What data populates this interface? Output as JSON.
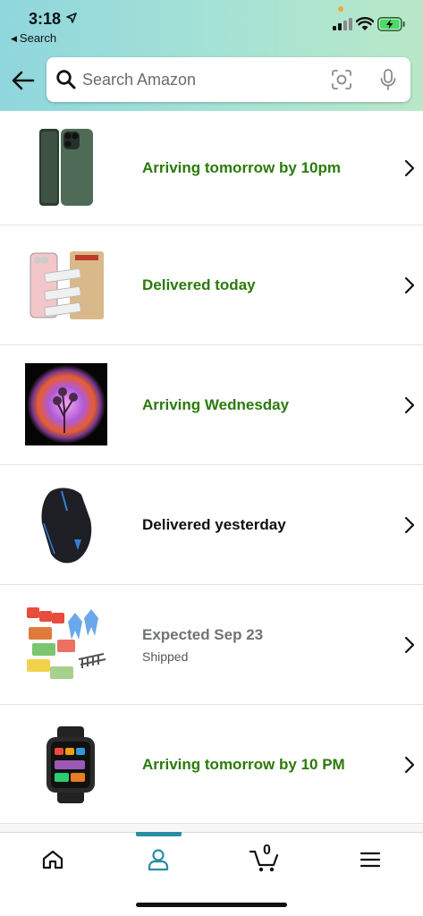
{
  "status_bar": {
    "time": "3:18",
    "back_app": "Search"
  },
  "search": {
    "placeholder": "Search Amazon"
  },
  "orders": [
    {
      "status": "Arriving tomorrow by 10pm",
      "status_color": "#2b7a0b",
      "subtext": "",
      "image": "green-phone-case"
    },
    {
      "status": "Delivered today",
      "status_color": "#2b7a0b",
      "subtext": "",
      "image": "screen-protector-pack"
    },
    {
      "status": "Arriving Wednesday",
      "status_color": "#2b7a0b",
      "subtext": "",
      "image": "sunset-lamp"
    },
    {
      "status": "Delivered yesterday",
      "status_color": "#0f1111",
      "subtext": "",
      "image": "gaming-mouse"
    },
    {
      "status": "Expected Sep 23",
      "status_color": "#6f7373",
      "subtext": "Shipped",
      "image": "storage-bags-set"
    },
    {
      "status": "Arriving tomorrow by 10 PM",
      "status_color": "#2b7a0b",
      "subtext": "",
      "image": "smart-watch"
    }
  ],
  "bottom_nav": {
    "items": [
      "home-icon",
      "account-icon",
      "cart-icon",
      "menu-icon"
    ],
    "active": "account-icon",
    "cart_count": "0",
    "accent": "#2a8ea0"
  }
}
